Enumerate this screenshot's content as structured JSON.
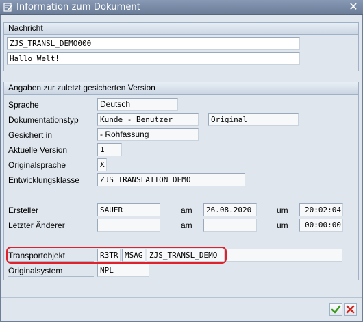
{
  "window": {
    "title": "Information zum Dokument",
    "close_glyph": "✕"
  },
  "nachricht": {
    "header": "Nachricht",
    "name": "ZJS_TRANSL_DEMO000",
    "text": "Hallo Welt!"
  },
  "version": {
    "header": "Angaben zur zuletzt gesicherten Version",
    "sprache_label": "Sprache",
    "sprache_value": "Deutsch",
    "doktyp_label": "Dokumentationstyp",
    "doktyp_value": "Kunde - Benutzer",
    "doktyp_value2": "Original",
    "gesichert_label": "Gesichert in",
    "gesichert_value": "- Rohfassung",
    "aktversion_label": "Aktuelle Version",
    "aktversion_value": "1",
    "origsprache_label": "Originalsprache",
    "origsprache_value": "X",
    "entwklasse_label": "Entwicklungsklasse",
    "entwklasse_value": "ZJS_TRANSLATION_DEMO",
    "ersteller_label": "Ersteller",
    "ersteller_value": "SAUER",
    "am_label": "am",
    "ersteller_date": "26.08.2020",
    "um_label": "um",
    "ersteller_time": "20:02:04",
    "letzter_label": "Letzter Änderer",
    "letzter_value": "",
    "letzter_date": "",
    "letzter_time": "00:00:00",
    "transport_label": "Transportobjekt",
    "transport_pgmid": "R3TR",
    "transport_type": "MSAG",
    "transport_name": "ZJS_TRANSL_DEMO",
    "transport_extra": "",
    "origsystem_label": "Originalsystem",
    "origsystem_value": "NPL"
  },
  "colors": {
    "highlight": "#e0202a",
    "confirm": "#3a9a1c",
    "cancel": "#d4261c"
  }
}
